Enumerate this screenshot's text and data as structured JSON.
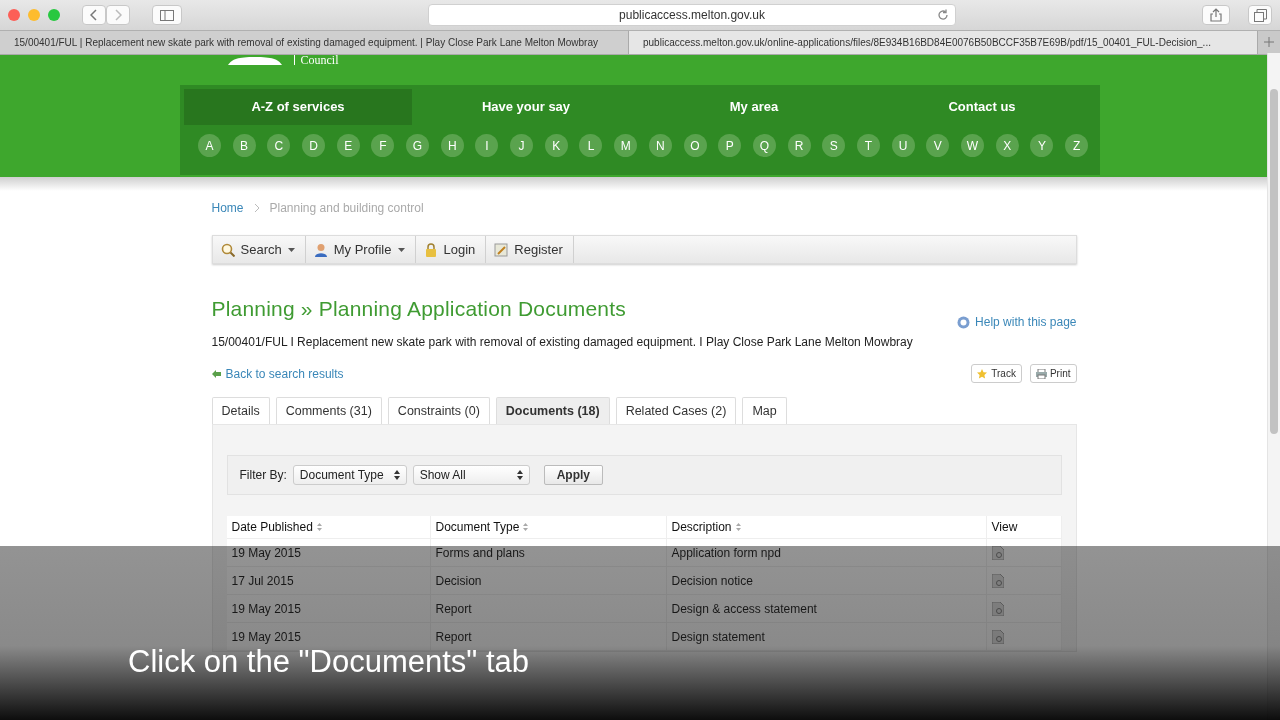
{
  "browser": {
    "url": "publicaccess.melton.gov.uk",
    "tabs": [
      {
        "title": "15/00401/FUL | Replacement new skate park with removal of existing damaged equipment. | Play Close Park Lane Melton Mowbray",
        "selected": false
      },
      {
        "title": "publicaccess.melton.gov.uk/online-applications/files/8E934B16BD84E0076B50BCCF35B7E69B/pdf/15_00401_FUL-Decision_...",
        "selected": true
      }
    ]
  },
  "site": {
    "logo_text": "Council",
    "nav": [
      {
        "label": "A-Z of services",
        "selected": true
      },
      {
        "label": "Have your say",
        "selected": false
      },
      {
        "label": "My area",
        "selected": false
      },
      {
        "label": "Contact us",
        "selected": false
      }
    ],
    "letters": [
      "A",
      "B",
      "C",
      "D",
      "E",
      "F",
      "G",
      "H",
      "I",
      "J",
      "K",
      "L",
      "M",
      "N",
      "O",
      "P",
      "Q",
      "R",
      "S",
      "T",
      "U",
      "V",
      "W",
      "X",
      "Y",
      "Z"
    ]
  },
  "breadcrumb": [
    "Home",
    "Planning and building control"
  ],
  "toolbar": [
    {
      "label": "Search",
      "has_menu": true
    },
    {
      "label": "My Profile",
      "has_menu": true
    },
    {
      "label": "Login",
      "has_menu": false
    },
    {
      "label": "Register",
      "has_menu": false
    }
  ],
  "heading": "Planning » Planning Application Documents",
  "help_link": "Help with this page",
  "application": "15/00401/FUL I Replacement new skate park with removal of existing damaged equipment. I Play Close Park Lane Melton Mowbray",
  "back_link": "Back to search results",
  "actions": [
    "Track",
    "Print"
  ],
  "tabs": [
    {
      "label": "Details",
      "selected": false
    },
    {
      "label": "Comments (31)",
      "selected": false
    },
    {
      "label": "Constraints (0)",
      "selected": false
    },
    {
      "label": "Documents (18)",
      "selected": true
    },
    {
      "label": "Related Cases (2)",
      "selected": false
    },
    {
      "label": "Map",
      "selected": false
    }
  ],
  "filter": {
    "label": "Filter By:",
    "selects": [
      "Document Type",
      "Show All"
    ],
    "button": "Apply"
  },
  "table": {
    "columns": [
      {
        "label": "Date Published",
        "sortable": true
      },
      {
        "label": "Document Type",
        "sortable": true
      },
      {
        "label": "Description",
        "sortable": true
      },
      {
        "label": "View",
        "sortable": false
      }
    ],
    "rows": [
      {
        "date": "19 May 2015",
        "type": "Forms and plans",
        "description": "Application form npd"
      },
      {
        "date": "17 Jul 2015",
        "type": "Decision",
        "description": "Decision notice"
      },
      {
        "date": "19 May 2015",
        "type": "Report",
        "description": "Design & access statement"
      },
      {
        "date": "19 May 2015",
        "type": "Report",
        "description": "Design statement"
      }
    ]
  },
  "caption": "Click on the \"Documents\" tab"
}
